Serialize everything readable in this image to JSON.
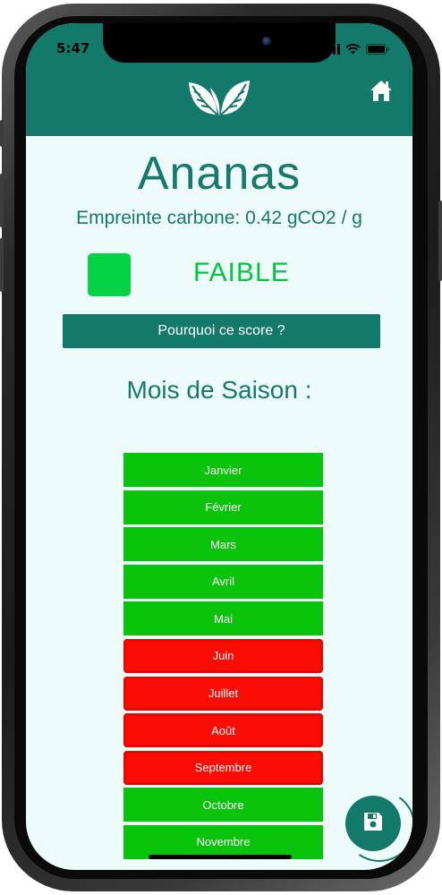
{
  "status_bar": {
    "time": "5:47"
  },
  "product": {
    "name": "Ananas",
    "carbon_footprint": "Empreinte carbone: 0.42 gCO2 / g",
    "score_label": "FAIBLE",
    "score_color": "#02d243"
  },
  "why_button": {
    "label": "Pourquoi ce score ?"
  },
  "season": {
    "title": "Mois de Saison :",
    "months": [
      {
        "label": "Janvier",
        "in_season": true
      },
      {
        "label": "Février",
        "in_season": true
      },
      {
        "label": "Mars",
        "in_season": true
      },
      {
        "label": "Avril",
        "in_season": true
      },
      {
        "label": "Mai",
        "in_season": true
      },
      {
        "label": "Juin",
        "in_season": false
      },
      {
        "label": "Juillet",
        "in_season": false
      },
      {
        "label": "Août",
        "in_season": false
      },
      {
        "label": "Septembre",
        "in_season": false
      },
      {
        "label": "Octobre",
        "in_season": true
      },
      {
        "label": "Novembre",
        "in_season": true
      }
    ]
  },
  "colors": {
    "header": "#137a6b",
    "in_season": "#0ac40c",
    "out_of_season": "#fb0d05"
  },
  "icons": {
    "logo": "leaves-icon",
    "home": "home-icon",
    "save": "floppy-disk-icon"
  }
}
